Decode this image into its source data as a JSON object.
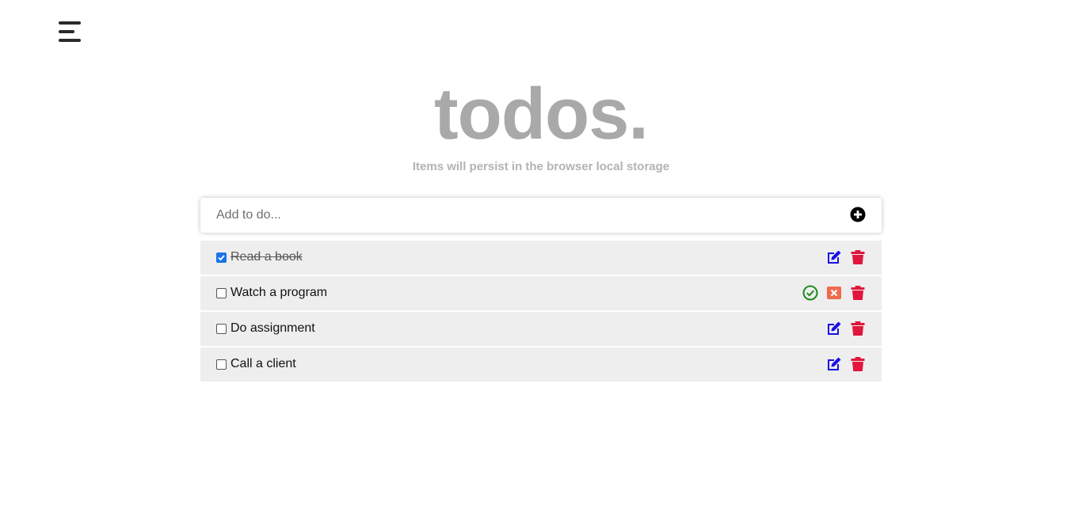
{
  "header": {
    "menu_icon": "hamburger-menu-icon",
    "title": "todos.",
    "subtitle": "Items will persist in the browser local storage"
  },
  "add": {
    "placeholder": "Add to do...",
    "button_icon": "plus-circle-icon"
  },
  "todos": [
    {
      "label": "Read a book",
      "completed": true,
      "editing": false
    },
    {
      "label": "Watch a program",
      "completed": false,
      "editing": true
    },
    {
      "label": "Do assignment",
      "completed": false,
      "editing": false
    },
    {
      "label": "Call a client",
      "completed": false,
      "editing": false
    }
  ],
  "colors": {
    "edit": "#1a10e6",
    "delete": "#e0163c",
    "confirm": "#1e8a1e",
    "cancel": "#f06a4c",
    "title": "#a9a9a9"
  }
}
